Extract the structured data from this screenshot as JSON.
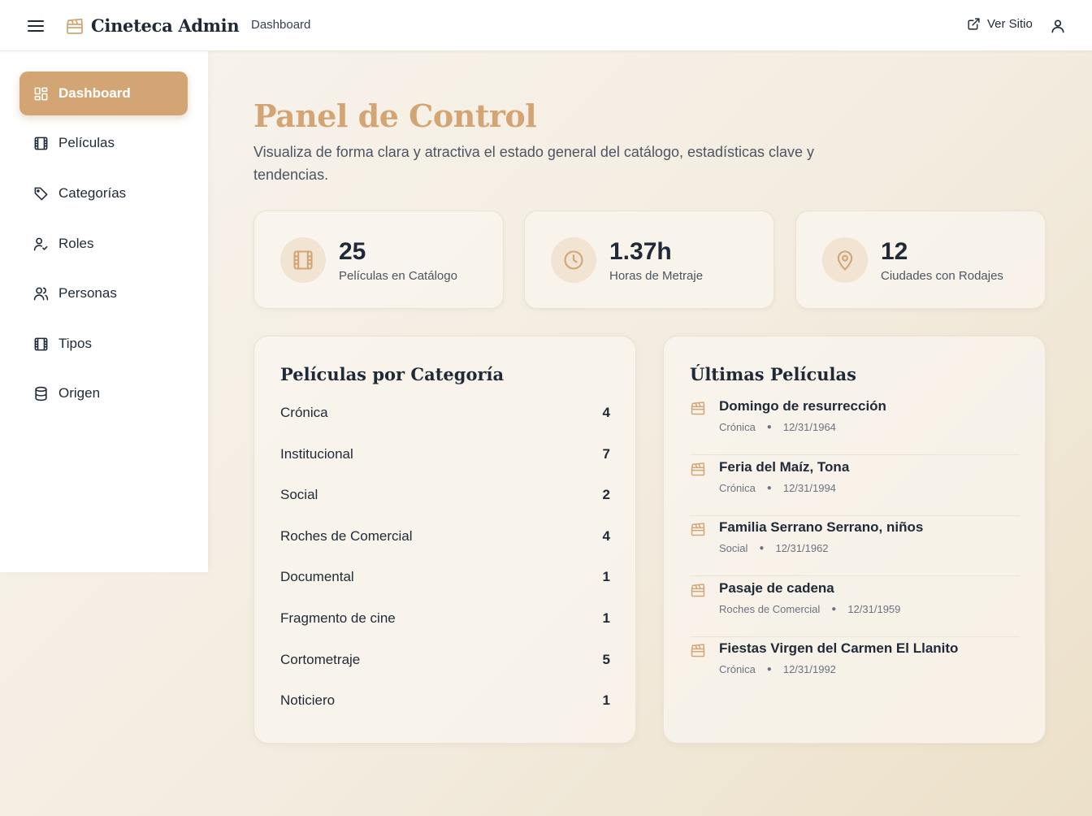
{
  "app": {
    "title": "Cineteca Admin",
    "breadcrumb": "Dashboard",
    "site_link_label": "Ver Sitio",
    "accent_color": "#d3a574"
  },
  "sidebar": {
    "items": [
      {
        "label": "Dashboard",
        "icon": "dashboard-grid-icon",
        "active": true
      },
      {
        "label": "Películas",
        "icon": "film-icon"
      },
      {
        "label": "Categorías",
        "icon": "tag-icon"
      },
      {
        "label": "Roles",
        "icon": "user-check-icon"
      },
      {
        "label": "Personas",
        "icon": "users-icon"
      },
      {
        "label": "Tipos",
        "icon": "film-icon"
      },
      {
        "label": "Origen",
        "icon": "database-icon"
      }
    ]
  },
  "main": {
    "title": "Panel de Control",
    "subtitle": "Visualiza de forma clara y atractiva el estado general del catálogo, estadísticas clave y tendencias."
  },
  "stats": [
    {
      "value": "25",
      "label": "Películas en Catálogo",
      "icon": "film-icon"
    },
    {
      "value": "1.37h",
      "label": "Horas de Metraje",
      "icon": "clock-icon"
    },
    {
      "value": "12",
      "label": "Ciudades con Rodajes",
      "icon": "map-pin-icon"
    }
  ],
  "categories_panel": {
    "title": "Películas por Categoría",
    "rows": [
      {
        "name": "Crónica",
        "count": "4"
      },
      {
        "name": "Institucional",
        "count": "7"
      },
      {
        "name": "Social",
        "count": "2"
      },
      {
        "name": "Roches de Comercial",
        "count": "4"
      },
      {
        "name": "Documental",
        "count": "1"
      },
      {
        "name": "Fragmento de cine",
        "count": "1"
      },
      {
        "name": "Cortometraje",
        "count": "5"
      },
      {
        "name": "Noticiero",
        "count": "1"
      }
    ]
  },
  "latest_panel": {
    "title": "Últimas Películas",
    "items": [
      {
        "title": "Domingo de resurrección",
        "category": "Crónica",
        "date": "12/31/1964",
        "icon": "clapperboard-icon"
      },
      {
        "title": "Feria del Maíz, Tona",
        "category": "Crónica",
        "date": "12/31/1994",
        "icon": "clapperboard-icon"
      },
      {
        "title": "Familia Serrano Serrano, niños",
        "category": "Social",
        "date": "12/31/1962",
        "icon": "clapperboard-icon"
      },
      {
        "title": "Pasaje de cadena",
        "category": "Roches de Comercial",
        "date": "12/31/1959",
        "icon": "clapperboard-icon"
      },
      {
        "title": "Fiestas Virgen del Carmen El Llanito",
        "category": "Crónica",
        "date": "12/31/1992",
        "icon": "clapperboard-icon"
      }
    ]
  }
}
